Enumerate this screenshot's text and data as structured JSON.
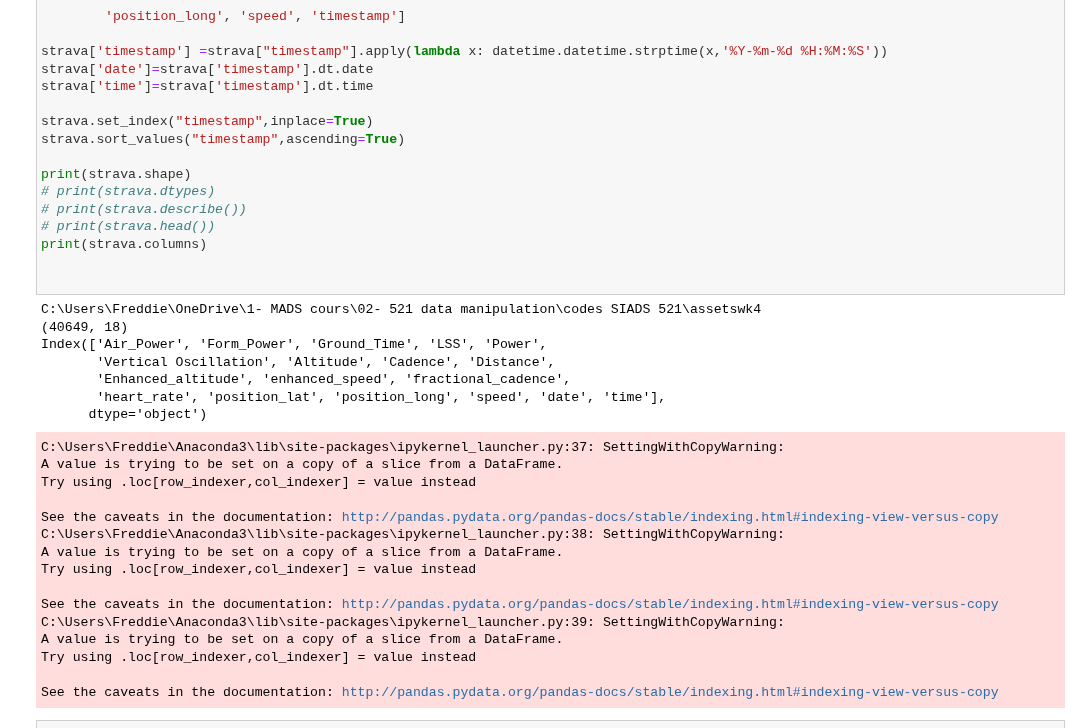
{
  "code_cell": {
    "continued_line": [
      {
        "kind": "str",
        "text": "'position_long'"
      },
      {
        "kind": "name",
        "text": ", "
      },
      {
        "kind": "str",
        "text": "'speed'"
      },
      {
        "kind": "name",
        "text": ", "
      },
      {
        "kind": "str",
        "text": "'timestamp'"
      },
      {
        "kind": "name",
        "text": "]"
      }
    ],
    "blocks": [
      [
        [
          {
            "kind": "name",
            "text": "strava["
          },
          {
            "kind": "str",
            "text": "'timestamp'"
          },
          {
            "kind": "name",
            "text": "] "
          },
          {
            "kind": "op",
            "text": "="
          },
          {
            "kind": "name",
            "text": "strava["
          },
          {
            "kind": "str",
            "text": "\"timestamp\""
          },
          {
            "kind": "name",
            "text": "].apply("
          },
          {
            "kind": "kw",
            "text": "lambda"
          },
          {
            "kind": "name",
            "text": " x: datetime.datetime.strptime(x,"
          },
          {
            "kind": "str",
            "text": "'%Y-%m-%d %H:%M:%S'"
          },
          {
            "kind": "name",
            "text": "))"
          }
        ],
        [
          {
            "kind": "name",
            "text": "strava["
          },
          {
            "kind": "str",
            "text": "'date'"
          },
          {
            "kind": "name",
            "text": "]"
          },
          {
            "kind": "op",
            "text": "="
          },
          {
            "kind": "name",
            "text": "strava["
          },
          {
            "kind": "str",
            "text": "'timestamp'"
          },
          {
            "kind": "name",
            "text": "].dt.date"
          }
        ],
        [
          {
            "kind": "name",
            "text": "strava["
          },
          {
            "kind": "str",
            "text": "'time'"
          },
          {
            "kind": "name",
            "text": "]"
          },
          {
            "kind": "op",
            "text": "="
          },
          {
            "kind": "name",
            "text": "strava["
          },
          {
            "kind": "str",
            "text": "'timestamp'"
          },
          {
            "kind": "name",
            "text": "].dt.time"
          }
        ]
      ],
      [
        [
          {
            "kind": "name",
            "text": "strava.set_index("
          },
          {
            "kind": "str",
            "text": "\"timestamp\""
          },
          {
            "kind": "name",
            "text": ",inplace"
          },
          {
            "kind": "op",
            "text": "="
          },
          {
            "kind": "kw",
            "text": "True"
          },
          {
            "kind": "name",
            "text": ")"
          }
        ],
        [
          {
            "kind": "name",
            "text": "strava.sort_values("
          },
          {
            "kind": "str",
            "text": "\"timestamp\""
          },
          {
            "kind": "name",
            "text": ",ascending"
          },
          {
            "kind": "op",
            "text": "="
          },
          {
            "kind": "kw",
            "text": "True"
          },
          {
            "kind": "name",
            "text": ")"
          }
        ]
      ],
      [
        [
          {
            "kind": "builtin",
            "text": "print"
          },
          {
            "kind": "name",
            "text": "(strava.shape)"
          }
        ],
        [
          {
            "kind": "comment",
            "text": "# print(strava.dtypes)"
          }
        ],
        [
          {
            "kind": "comment",
            "text": "# print(strava.describe())"
          }
        ],
        [
          {
            "kind": "comment",
            "text": "# print(strava.head())"
          }
        ],
        [
          {
            "kind": "builtin",
            "text": "print"
          },
          {
            "kind": "name",
            "text": "(strava.columns)"
          }
        ]
      ]
    ]
  },
  "output": {
    "stdout": [
      "C:\\Users\\Freddie\\OneDrive\\1- MADS cours\\02- 521 data manipulation\\codes SIADS 521\\assetswk4",
      "(40649, 18)",
      "Index(['Air_Power', 'Form_Power', 'Ground_Time', 'LSS', 'Power',",
      "       'Vertical Oscillation', 'Altitude', 'Cadence', 'Distance',",
      "       'Enhanced_altitude', 'enhanced_speed', 'fractional_cadence',",
      "       'heart_rate', 'position_lat', 'position_long', 'speed', 'date', 'time'],",
      "      dtype='object')"
    ],
    "stderr": [
      [
        {
          "text": "C:\\Users\\Freddie\\Anaconda3\\lib\\site-packages\\ipykernel_launcher.py:37: SettingWithCopyWarning:"
        },
        {
          "text": "A value is trying to be set on a copy of a slice from a DataFrame."
        },
        {
          "text": "Try using .loc[row_indexer,col_indexer] = value instead"
        }
      ],
      [
        {
          "text": "See the caveats in the documentation: ",
          "link": "http://pandas.pydata.org/pandas-docs/stable/indexing.html#indexing-view-versus-copy"
        },
        {
          "text": "C:\\Users\\Freddie\\Anaconda3\\lib\\site-packages\\ipykernel_launcher.py:38: SettingWithCopyWarning:"
        },
        {
          "text": "A value is trying to be set on a copy of a slice from a DataFrame."
        },
        {
          "text": "Try using .loc[row_indexer,col_indexer] = value instead"
        }
      ],
      [
        {
          "text": "See the caveats in the documentation: ",
          "link": "http://pandas.pydata.org/pandas-docs/stable/indexing.html#indexing-view-versus-copy"
        },
        {
          "text": "C:\\Users\\Freddie\\Anaconda3\\lib\\site-packages\\ipykernel_launcher.py:39: SettingWithCopyWarning:"
        },
        {
          "text": "A value is trying to be set on a copy of a slice from a DataFrame."
        },
        {
          "text": "Try using .loc[row_indexer,col_indexer] = value instead"
        }
      ],
      [
        {
          "text": "See the caveats in the documentation: ",
          "link": "http://pandas.pydata.org/pandas-docs/stable/indexing.html#indexing-view-versus-copy"
        }
      ]
    ]
  }
}
